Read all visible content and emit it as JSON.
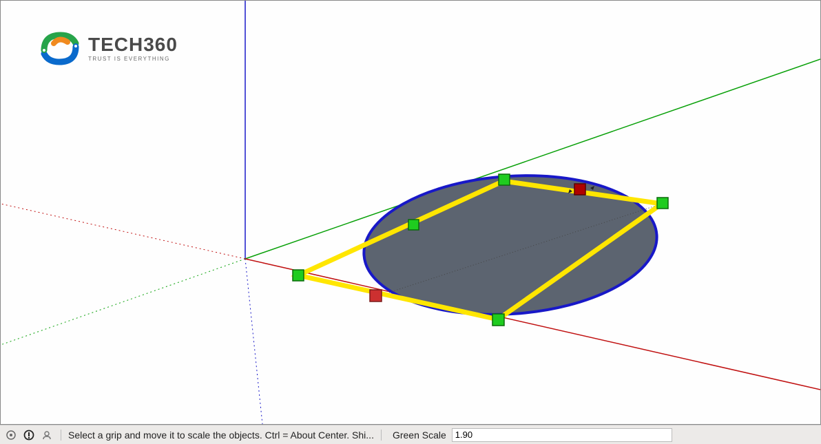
{
  "logo": {
    "title": "TECH360",
    "subtitle": "TRUST IS EVERYTHING"
  },
  "statusbar": {
    "hint": "Select a grip and move it to scale the objects. Ctrl = About Center. Shi...",
    "label": "Green Scale",
    "value": "1.90"
  },
  "axes": {
    "blue": "#1818c8",
    "green": "#08a008",
    "red": "#c01010"
  },
  "scale_box": {
    "frame_color": "#ffe600",
    "handle_green": "#1fcc1f",
    "handle_red": "#cc3030",
    "handle_active": "#b00000"
  },
  "ellipse": {
    "fill": "#5c6470",
    "stroke": "#1818c8"
  }
}
